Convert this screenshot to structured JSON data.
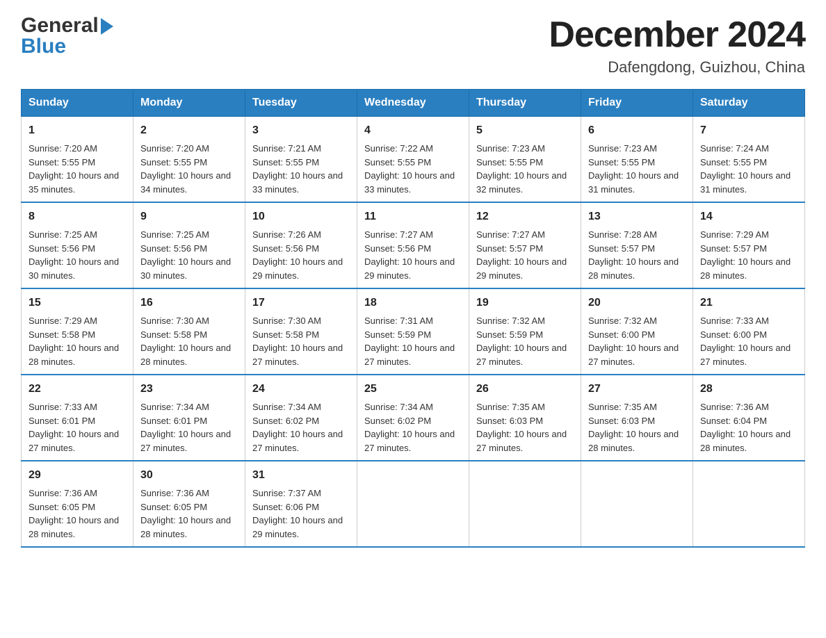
{
  "logo": {
    "general": "General",
    "blue": "Blue"
  },
  "title": "December 2024",
  "subtitle": "Dafengdong, Guizhou, China",
  "days": [
    "Sunday",
    "Monday",
    "Tuesday",
    "Wednesday",
    "Thursday",
    "Friday",
    "Saturday"
  ],
  "weeks": [
    [
      {
        "num": "1",
        "sunrise": "7:20 AM",
        "sunset": "5:55 PM",
        "daylight": "10 hours and 35 minutes."
      },
      {
        "num": "2",
        "sunrise": "7:20 AM",
        "sunset": "5:55 PM",
        "daylight": "10 hours and 34 minutes."
      },
      {
        "num": "3",
        "sunrise": "7:21 AM",
        "sunset": "5:55 PM",
        "daylight": "10 hours and 33 minutes."
      },
      {
        "num": "4",
        "sunrise": "7:22 AM",
        "sunset": "5:55 PM",
        "daylight": "10 hours and 33 minutes."
      },
      {
        "num": "5",
        "sunrise": "7:23 AM",
        "sunset": "5:55 PM",
        "daylight": "10 hours and 32 minutes."
      },
      {
        "num": "6",
        "sunrise": "7:23 AM",
        "sunset": "5:55 PM",
        "daylight": "10 hours and 31 minutes."
      },
      {
        "num": "7",
        "sunrise": "7:24 AM",
        "sunset": "5:55 PM",
        "daylight": "10 hours and 31 minutes."
      }
    ],
    [
      {
        "num": "8",
        "sunrise": "7:25 AM",
        "sunset": "5:56 PM",
        "daylight": "10 hours and 30 minutes."
      },
      {
        "num": "9",
        "sunrise": "7:25 AM",
        "sunset": "5:56 PM",
        "daylight": "10 hours and 30 minutes."
      },
      {
        "num": "10",
        "sunrise": "7:26 AM",
        "sunset": "5:56 PM",
        "daylight": "10 hours and 29 minutes."
      },
      {
        "num": "11",
        "sunrise": "7:27 AM",
        "sunset": "5:56 PM",
        "daylight": "10 hours and 29 minutes."
      },
      {
        "num": "12",
        "sunrise": "7:27 AM",
        "sunset": "5:57 PM",
        "daylight": "10 hours and 29 minutes."
      },
      {
        "num": "13",
        "sunrise": "7:28 AM",
        "sunset": "5:57 PM",
        "daylight": "10 hours and 28 minutes."
      },
      {
        "num": "14",
        "sunrise": "7:29 AM",
        "sunset": "5:57 PM",
        "daylight": "10 hours and 28 minutes."
      }
    ],
    [
      {
        "num": "15",
        "sunrise": "7:29 AM",
        "sunset": "5:58 PM",
        "daylight": "10 hours and 28 minutes."
      },
      {
        "num": "16",
        "sunrise": "7:30 AM",
        "sunset": "5:58 PM",
        "daylight": "10 hours and 28 minutes."
      },
      {
        "num": "17",
        "sunrise": "7:30 AM",
        "sunset": "5:58 PM",
        "daylight": "10 hours and 27 minutes."
      },
      {
        "num": "18",
        "sunrise": "7:31 AM",
        "sunset": "5:59 PM",
        "daylight": "10 hours and 27 minutes."
      },
      {
        "num": "19",
        "sunrise": "7:32 AM",
        "sunset": "5:59 PM",
        "daylight": "10 hours and 27 minutes."
      },
      {
        "num": "20",
        "sunrise": "7:32 AM",
        "sunset": "6:00 PM",
        "daylight": "10 hours and 27 minutes."
      },
      {
        "num": "21",
        "sunrise": "7:33 AM",
        "sunset": "6:00 PM",
        "daylight": "10 hours and 27 minutes."
      }
    ],
    [
      {
        "num": "22",
        "sunrise": "7:33 AM",
        "sunset": "6:01 PM",
        "daylight": "10 hours and 27 minutes."
      },
      {
        "num": "23",
        "sunrise": "7:34 AM",
        "sunset": "6:01 PM",
        "daylight": "10 hours and 27 minutes."
      },
      {
        "num": "24",
        "sunrise": "7:34 AM",
        "sunset": "6:02 PM",
        "daylight": "10 hours and 27 minutes."
      },
      {
        "num": "25",
        "sunrise": "7:34 AM",
        "sunset": "6:02 PM",
        "daylight": "10 hours and 27 minutes."
      },
      {
        "num": "26",
        "sunrise": "7:35 AM",
        "sunset": "6:03 PM",
        "daylight": "10 hours and 27 minutes."
      },
      {
        "num": "27",
        "sunrise": "7:35 AM",
        "sunset": "6:03 PM",
        "daylight": "10 hours and 28 minutes."
      },
      {
        "num": "28",
        "sunrise": "7:36 AM",
        "sunset": "6:04 PM",
        "daylight": "10 hours and 28 minutes."
      }
    ],
    [
      {
        "num": "29",
        "sunrise": "7:36 AM",
        "sunset": "6:05 PM",
        "daylight": "10 hours and 28 minutes."
      },
      {
        "num": "30",
        "sunrise": "7:36 AM",
        "sunset": "6:05 PM",
        "daylight": "10 hours and 28 minutes."
      },
      {
        "num": "31",
        "sunrise": "7:37 AM",
        "sunset": "6:06 PM",
        "daylight": "10 hours and 29 minutes."
      },
      null,
      null,
      null,
      null
    ]
  ],
  "labels": {
    "sunrise": "Sunrise:",
    "sunset": "Sunset:",
    "daylight": "Daylight:"
  }
}
